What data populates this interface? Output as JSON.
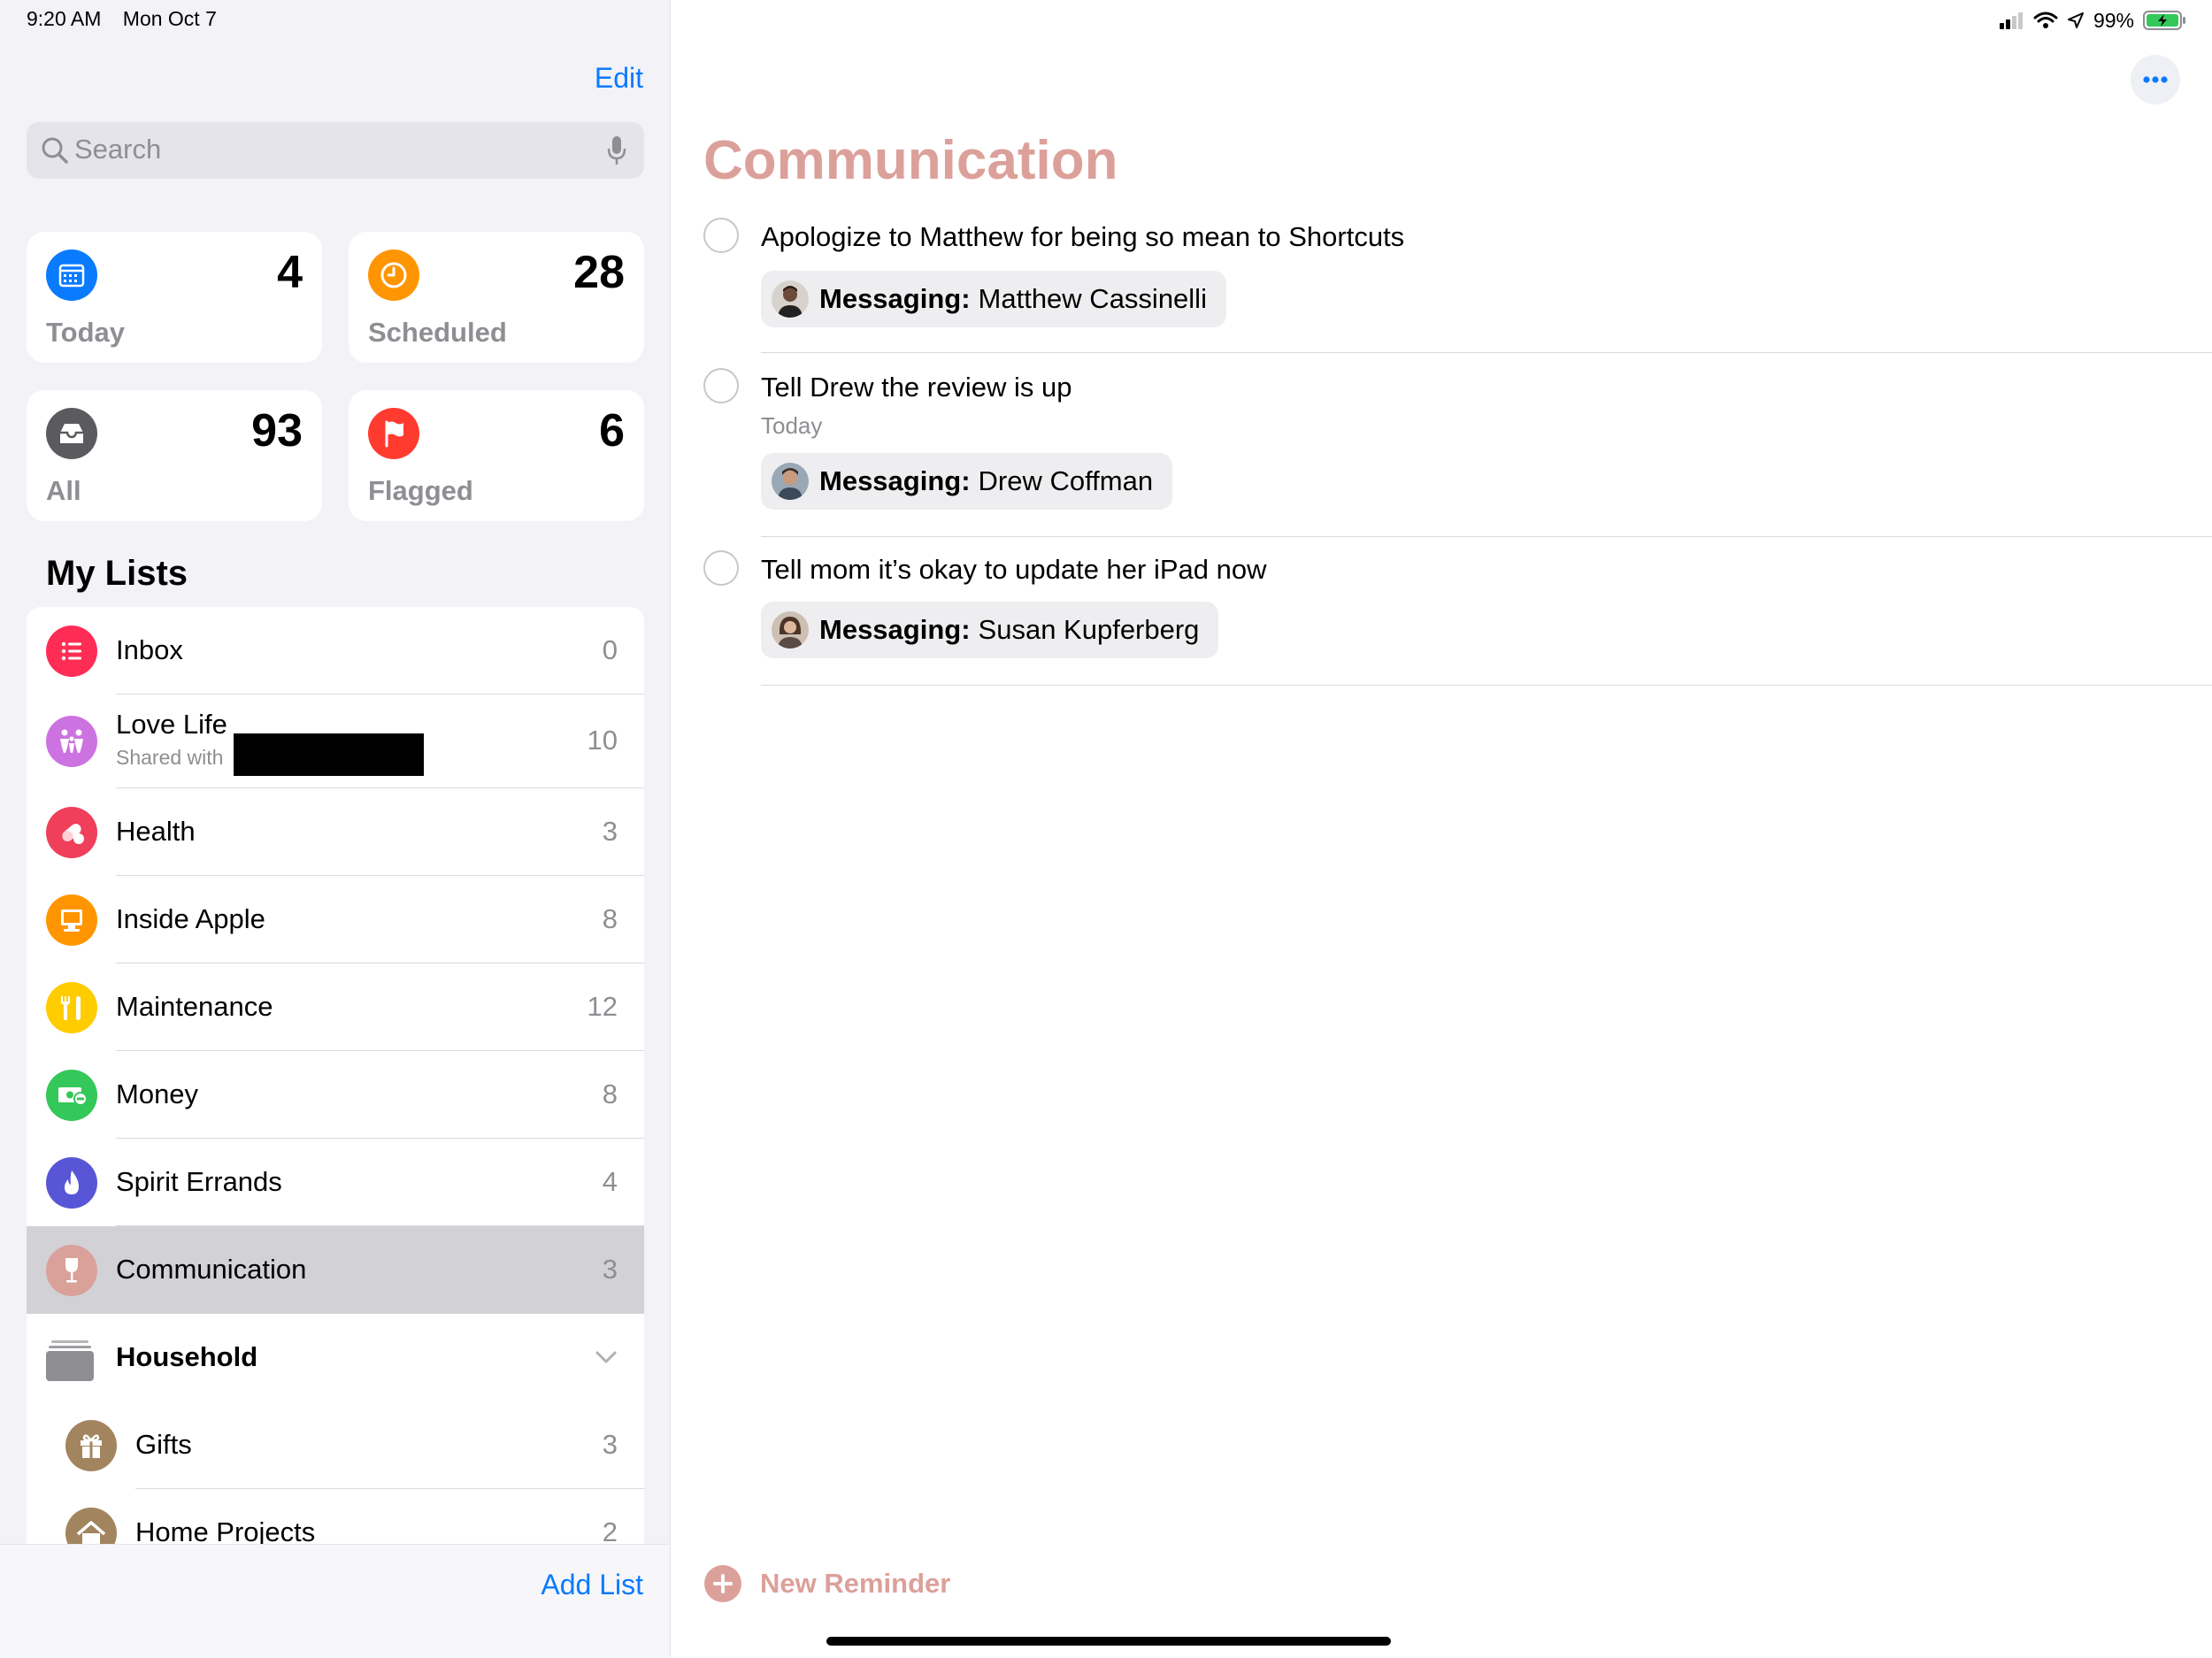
{
  "status_bar": {
    "time": "9:20 AM",
    "date": "Mon Oct 7",
    "battery": "99%"
  },
  "sidebar": {
    "edit_label": "Edit",
    "search_placeholder": "Search",
    "smart_lists": [
      {
        "label": "Today",
        "count": "4",
        "color": "#0a7aff",
        "icon": "calendar-icon"
      },
      {
        "label": "Scheduled",
        "count": "28",
        "color": "#ff9500",
        "icon": "clock-icon"
      },
      {
        "label": "All",
        "count": "93",
        "color": "#5a5a5f",
        "icon": "tray-icon"
      },
      {
        "label": "Flagged",
        "count": "6",
        "color": "#ff3b30",
        "icon": "flag-icon"
      }
    ],
    "my_lists_title": "My Lists",
    "lists": [
      {
        "label": "Inbox",
        "count": "0",
        "color": "#ff2d55",
        "icon": "list-icon"
      },
      {
        "label": "Love Life",
        "subtitle": "Shared with",
        "count": "10",
        "color": "#cc73e1",
        "icon": "people-icon"
      },
      {
        "label": "Health",
        "count": "3",
        "color": "#ef3f5a",
        "icon": "pills-icon"
      },
      {
        "label": "Inside Apple",
        "count": "8",
        "color": "#ff9500",
        "icon": "desktop-icon"
      },
      {
        "label": "Maintenance",
        "count": "12",
        "color": "#ffcc00",
        "icon": "tools-icon"
      },
      {
        "label": "Money",
        "count": "8",
        "color": "#34c759",
        "icon": "money-icon"
      },
      {
        "label": "Spirit Errands",
        "count": "4",
        "color": "#5856d6",
        "icon": "flame-icon"
      },
      {
        "label": "Communication",
        "count": "3",
        "color": "#d9a19a",
        "icon": "wineglass-icon",
        "selected": true
      }
    ],
    "group": {
      "label": "Household",
      "color": "#8e8e93"
    },
    "group_lists": [
      {
        "label": "Gifts",
        "count": "3",
        "color": "#a2845e",
        "icon": "gift-icon"
      },
      {
        "label": "Home Projects",
        "count": "2",
        "color": "#a2845e",
        "icon": "house-icon"
      }
    ],
    "add_list_label": "Add List"
  },
  "main": {
    "title": "Communication",
    "accent": "#dca09a",
    "reminders": [
      {
        "title": "Apologize to Matthew for being so mean to Shortcuts",
        "app": "Messaging:",
        "contact": "Matthew Cassinelli"
      },
      {
        "title": "Tell Drew the review is up",
        "date": "Today",
        "app": "Messaging:",
        "contact": "Drew Coffman"
      },
      {
        "title": "Tell mom it’s okay to update her iPad now",
        "app": "Messaging:",
        "contact": "Susan Kupferberg"
      }
    ],
    "new_reminder_label": "New Reminder"
  }
}
